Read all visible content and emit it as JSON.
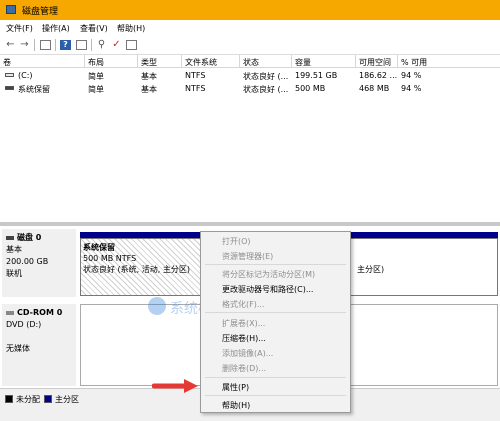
{
  "window": {
    "title": "磁盘管理"
  },
  "menu": [
    "文件(F)",
    "操作(A)",
    "查看(V)",
    "帮助(H)"
  ],
  "toolbar_icons": [
    "back-arrow-icon",
    "forward-arrow-icon",
    "show-hide-console-tree-icon",
    "help-icon",
    "properties-icon",
    "connect-icon",
    "checklist-icon",
    "console-icon"
  ],
  "volumes": {
    "headers": [
      "卷",
      "布局",
      "类型",
      "文件系统",
      "状态",
      "容量",
      "可用空间",
      "% 可用"
    ],
    "rows": [
      [
        "(C:)",
        "简单",
        "基本",
        "NTFS",
        "状态良好 (...",
        "199.51 GB",
        "186.62 ...",
        "94 %"
      ],
      [
        "系统保留",
        "简单",
        "基本",
        "NTFS",
        "状态良好 (...",
        "500 MB",
        "468 MB",
        "94 %"
      ]
    ]
  },
  "disk0": {
    "name": "磁盘 0",
    "type": "基本",
    "size": "200.00 GB",
    "status": "联机",
    "partition_name": "系统保留",
    "partition_size": "500 MB NTFS",
    "partition_status": "状态良好 (系统, 活动, 主分区)",
    "c_status_tail": "主分区)"
  },
  "cdrom0": {
    "name": "CD-ROM 0",
    "type": "DVD (D:)",
    "status": "无媒体"
  },
  "legend": {
    "unallocated": "未分配",
    "primary": "主分区",
    "unallocated_color": "#000000",
    "primary_color": "#00008b"
  },
  "context_menu": {
    "open": "打开(O)",
    "explore": "资源管理器(E)",
    "mark_active": "将分区标记为活动分区(M)",
    "change_letter": "更改驱动器号和路径(C)...",
    "format": "格式化(F)...",
    "extend": "扩展卷(X)...",
    "shrink": "压缩卷(H)...",
    "add_mirror": "添加镜像(A)...",
    "delete": "删除卷(D)...",
    "properties": "属性(P)",
    "help": "帮助(H)"
  },
  "watermark": "系统极客",
  "colors": {
    "titlebar": "#f6a800",
    "disk_bar": "#00008b",
    "arrow": "#e53935"
  }
}
